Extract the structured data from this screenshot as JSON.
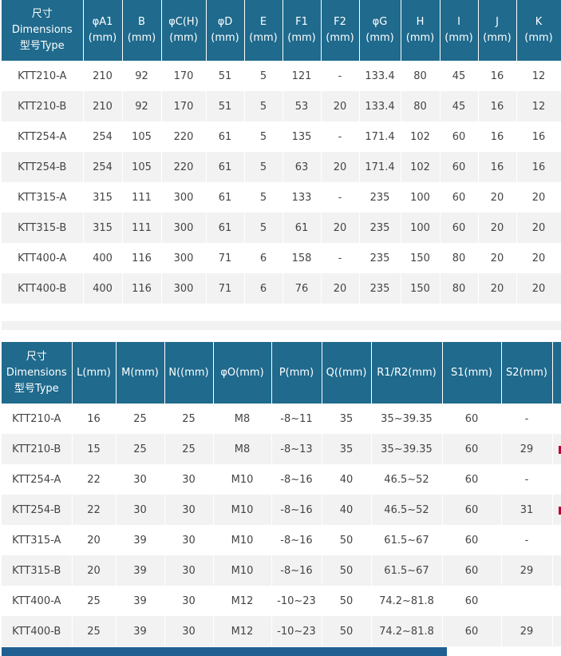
{
  "table1": {
    "headers": [
      "尺寸\nDimensions\n型号Type",
      "φA1\n(mm)",
      "B\n(mm)",
      "φC(H)\n(mm)",
      "φD\n(mm)",
      "E\n(mm)",
      "F1\n(mm)",
      "F2\n(mm)",
      "φG\n(mm)",
      "H\n(mm)",
      "I\n(mm)",
      "J\n(mm)",
      "K\n(mm)"
    ],
    "rows": [
      [
        "KTT210-A",
        "210",
        "92",
        "170",
        "51",
        "5",
        "121",
        "-",
        "133.4",
        "80",
        "45",
        "16",
        "12"
      ],
      [
        "KTT210-B",
        "210",
        "92",
        "170",
        "51",
        "5",
        "53",
        "20",
        "133.4",
        "80",
        "45",
        "16",
        "12"
      ],
      [
        "KTT254-A",
        "254",
        "105",
        "220",
        "61",
        "5",
        "135",
        "-",
        "171.4",
        "102",
        "60",
        "16",
        "16"
      ],
      [
        "KTT254-B",
        "254",
        "105",
        "220",
        "61",
        "5",
        "63",
        "20",
        "171.4",
        "102",
        "60",
        "16",
        "16"
      ],
      [
        "KTT315-A",
        "315",
        "111",
        "300",
        "61",
        "5",
        "133",
        "-",
        "235",
        "100",
        "60",
        "20",
        "20"
      ],
      [
        "KTT315-B",
        "315",
        "111",
        "300",
        "61",
        "5",
        "61",
        "20",
        "235",
        "100",
        "60",
        "20",
        "20"
      ],
      [
        "KTT400-A",
        "400",
        "116",
        "300",
        "71",
        "6",
        "158",
        "-",
        "235",
        "150",
        "80",
        "20",
        "20"
      ],
      [
        "KTT400-B",
        "400",
        "116",
        "300",
        "71",
        "6",
        "76",
        "20",
        "235",
        "150",
        "80",
        "20",
        "20"
      ]
    ]
  },
  "table2": {
    "headers": [
      "尺寸\nDimensions\n型号Type",
      "L(mm)",
      "M(mm)",
      "N((mm)",
      "φO(mm)",
      "P(mm)",
      "Q((mm)",
      "R1/R2(mm)",
      "S1(mm)",
      "S2(mm)",
      ""
    ],
    "rows": [
      [
        "KTT210-A",
        "16",
        "25",
        "25",
        "M8",
        "-8~11",
        "35",
        "35~39.35",
        "60",
        "-",
        ""
      ],
      [
        "KTT210-B",
        "15",
        "25",
        "25",
        "M8",
        "-8~13",
        "35",
        "35~39.35",
        "60",
        "29",
        ""
      ],
      [
        "KTT254-A",
        "22",
        "30",
        "30",
        "M10",
        "-8~16",
        "40",
        "46.5~52",
        "60",
        "-",
        ""
      ],
      [
        "KTT254-B",
        "22",
        "30",
        "30",
        "M10",
        "-8~16",
        "40",
        "46.5~52",
        "60",
        "31",
        ""
      ],
      [
        "KTT315-A",
        "20",
        "39",
        "30",
        "M10",
        "-8~16",
        "50",
        "61.5~67",
        "60",
        "-",
        ""
      ],
      [
        "KTT315-B",
        "20",
        "39",
        "30",
        "M10",
        "-8~16",
        "50",
        "61.5~67",
        "60",
        "29",
        ""
      ],
      [
        "KTT400-A",
        "25",
        "39",
        "30",
        "M12",
        "-10~23",
        "50",
        "74.2~81.8",
        "60",
        "",
        ""
      ],
      [
        "KTT400-B",
        "25",
        "39",
        "30",
        "M12",
        "-10~23",
        "50",
        "74.2~81.8",
        "60",
        "29",
        ""
      ]
    ]
  },
  "colors": {
    "header_bg": "#1f6a8d",
    "row_alt": "#f2f2f2",
    "scrollbar": "#1f5f91"
  }
}
